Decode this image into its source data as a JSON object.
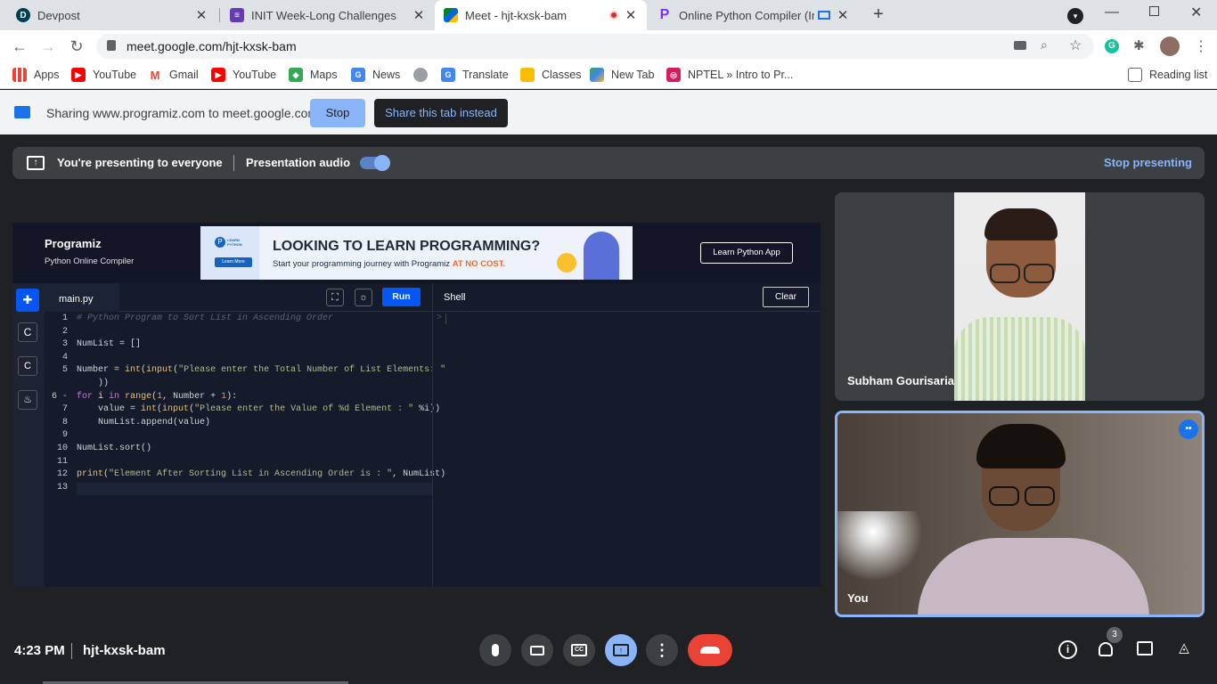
{
  "browser": {
    "tabs": [
      {
        "title": "Devpost",
        "icon": "devpost-icon"
      },
      {
        "title": "INIT Week-Long Challenges",
        "icon": "forms-icon"
      },
      {
        "title": "Meet - hjt-kxsk-bam",
        "icon": "meet-icon"
      },
      {
        "title": "Online Python Compiler (Inte",
        "icon": "programiz-icon"
      }
    ],
    "url": "meet.google.com/hjt-kxsk-bam",
    "bookmarks": [
      "Apps",
      "YouTube",
      "Gmail",
      "YouTube",
      "Maps",
      "News",
      "Translate",
      "Classes",
      "New Tab",
      "NPTEL » Intro to Pr..."
    ],
    "reading_list": "Reading list"
  },
  "share_bar": {
    "text": "Sharing www.programiz.com to meet.google.com",
    "stop": "Stop",
    "share_tab": "Share this tab instead"
  },
  "presenting": {
    "text": "You're presenting to everyone",
    "audio_label": "Presentation audio",
    "stop": "Stop presenting"
  },
  "programiz": {
    "brand": "rogramiz",
    "brand_p": "P",
    "subtitle": "Python Online Compiler",
    "ad_headline": "LOOKING TO LEARN PROGRAMMING?",
    "ad_sub": "Start your programming journey with Programiz ",
    "ad_sub_accent": "AT NO COST.",
    "ad_badge": "LEARN PYTHON",
    "ad_btn": "Learn More",
    "learn_app": "Learn Python App",
    "file_tab": "main.py",
    "run": "Run",
    "shell": "Shell",
    "clear": "Clear",
    "shell_prompt": ">",
    "line_numbers": [
      "1",
      "2",
      "3",
      "4",
      "5",
      "",
      "6 -",
      "7",
      "8",
      "9",
      "10",
      "11",
      "12",
      "13"
    ],
    "code_lines": [
      "# Python Program to Sort List in Ascending Order",
      "",
      "NumList = []",
      "",
      "Number = int(input(\"Please enter the Total Number of List Elements: \"",
      "    ))",
      "for i in range(1, Number + 1):",
      "    value = int(input(\"Please enter the Value of %d Element : \" %i))",
      "    NumList.append(value)",
      "",
      "NumList.sort()",
      "",
      "print(\"Element After Sorting List in Ascending Order is : \", NumList)",
      ""
    ]
  },
  "participants": [
    {
      "name": "Subham Gourisaria"
    },
    {
      "name": "You"
    }
  ],
  "meeting": {
    "time": "4:23 PM",
    "code": "hjt-kxsk-bam",
    "people_count": "3"
  },
  "colors": {
    "accent_blue": "#8ab4f8",
    "end_call_red": "#ea4335",
    "run_blue": "#0556f3"
  }
}
